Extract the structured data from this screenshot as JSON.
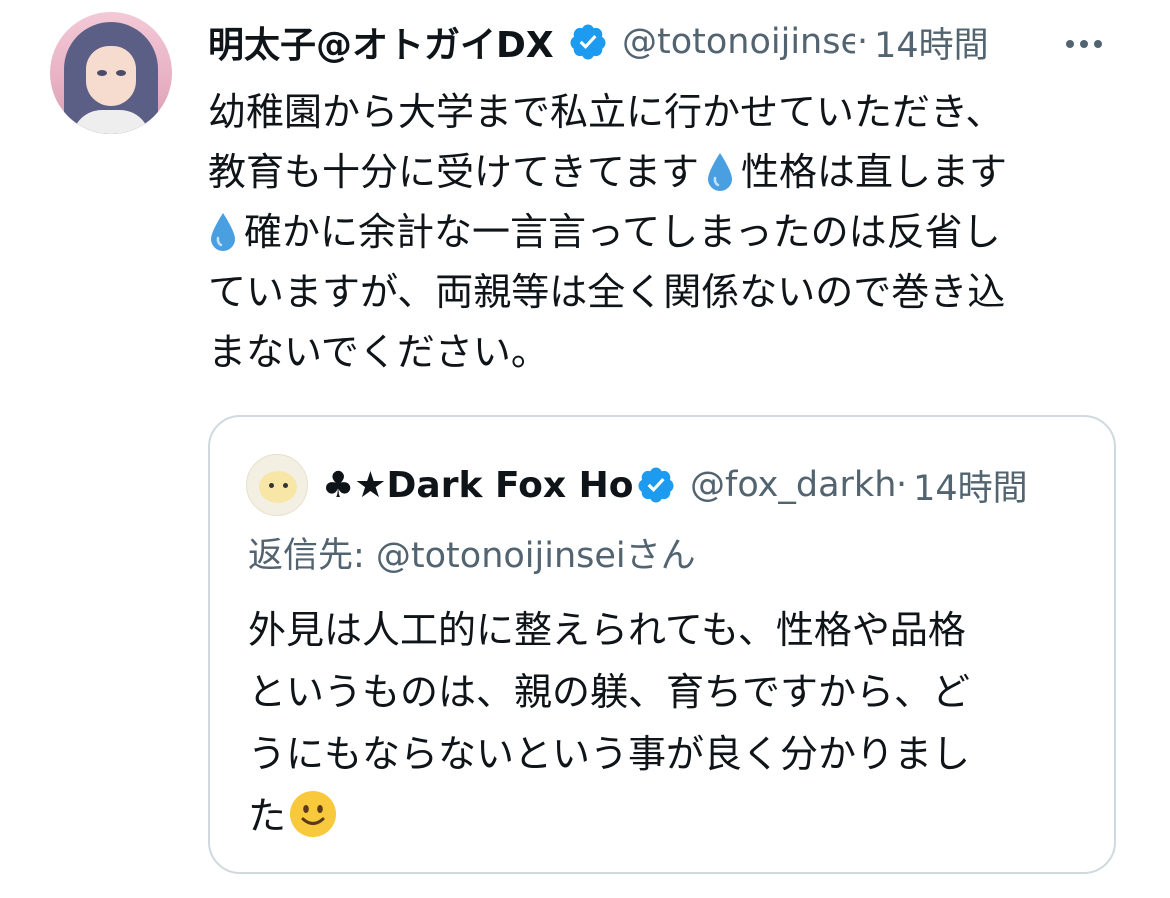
{
  "tweet": {
    "author_name": "明太子@オトガイDX",
    "handle": "@totonoijinsei",
    "separator": "·",
    "time": "14時間",
    "body_line1": "幼稚園から大学まで私立に行かせていただき、",
    "body_line2a": "教育も十分に受けてきてます",
    "body_line2b": "性格は直します",
    "body_line3": "確かに余計な一言言ってしまったのは反省し",
    "body_line4": "ていますが、両親等は全く関係ないので巻き込",
    "body_line5": "まないでください。"
  },
  "quoted": {
    "author_name": "♣★Dark Fox Hole",
    "handle": "@fox_darkhole",
    "separator": "·",
    "time": "14時間",
    "reply_to": "返信先: @totonoijinseiさん",
    "line1": "外見は人工的に整えられても、性格や品格",
    "line2": "というものは、親の躾、育ちですから、ど",
    "line3": "うにもならないという事が良く分かりまし",
    "line4": "た"
  },
  "icons": {
    "verified": "verified-badge-icon",
    "more": "more-icon",
    "droplet": "droplet-emoji-icon",
    "smile": "smile-emoji-icon"
  },
  "colors": {
    "verified_blue": "#1d9bf0",
    "secondary_text": "#536471",
    "border": "#cfd9de"
  }
}
